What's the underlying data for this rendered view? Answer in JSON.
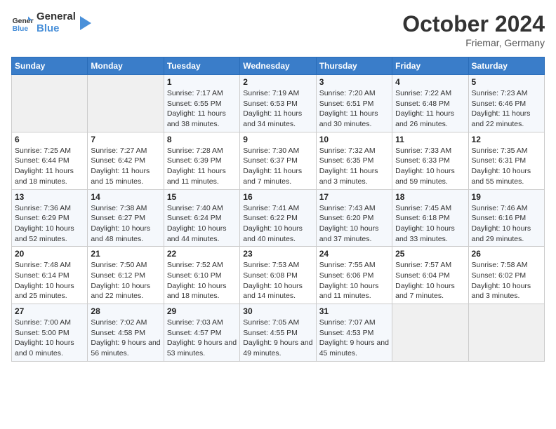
{
  "header": {
    "logo_general": "General",
    "logo_blue": "Blue",
    "month_title": "October 2024",
    "location": "Friemar, Germany"
  },
  "days_of_week": [
    "Sunday",
    "Monday",
    "Tuesday",
    "Wednesday",
    "Thursday",
    "Friday",
    "Saturday"
  ],
  "weeks": [
    [
      {
        "day": "",
        "empty": true
      },
      {
        "day": "",
        "empty": true
      },
      {
        "day": "1",
        "sunrise": "7:17 AM",
        "sunset": "6:55 PM",
        "daylight": "11 hours and 38 minutes."
      },
      {
        "day": "2",
        "sunrise": "7:19 AM",
        "sunset": "6:53 PM",
        "daylight": "11 hours and 34 minutes."
      },
      {
        "day": "3",
        "sunrise": "7:20 AM",
        "sunset": "6:51 PM",
        "daylight": "11 hours and 30 minutes."
      },
      {
        "day": "4",
        "sunrise": "7:22 AM",
        "sunset": "6:48 PM",
        "daylight": "11 hours and 26 minutes."
      },
      {
        "day": "5",
        "sunrise": "7:23 AM",
        "sunset": "6:46 PM",
        "daylight": "11 hours and 22 minutes."
      }
    ],
    [
      {
        "day": "6",
        "sunrise": "7:25 AM",
        "sunset": "6:44 PM",
        "daylight": "11 hours and 18 minutes."
      },
      {
        "day": "7",
        "sunrise": "7:27 AM",
        "sunset": "6:42 PM",
        "daylight": "11 hours and 15 minutes."
      },
      {
        "day": "8",
        "sunrise": "7:28 AM",
        "sunset": "6:39 PM",
        "daylight": "11 hours and 11 minutes."
      },
      {
        "day": "9",
        "sunrise": "7:30 AM",
        "sunset": "6:37 PM",
        "daylight": "11 hours and 7 minutes."
      },
      {
        "day": "10",
        "sunrise": "7:32 AM",
        "sunset": "6:35 PM",
        "daylight": "11 hours and 3 minutes."
      },
      {
        "day": "11",
        "sunrise": "7:33 AM",
        "sunset": "6:33 PM",
        "daylight": "10 hours and 59 minutes."
      },
      {
        "day": "12",
        "sunrise": "7:35 AM",
        "sunset": "6:31 PM",
        "daylight": "10 hours and 55 minutes."
      }
    ],
    [
      {
        "day": "13",
        "sunrise": "7:36 AM",
        "sunset": "6:29 PM",
        "daylight": "10 hours and 52 minutes."
      },
      {
        "day": "14",
        "sunrise": "7:38 AM",
        "sunset": "6:27 PM",
        "daylight": "10 hours and 48 minutes."
      },
      {
        "day": "15",
        "sunrise": "7:40 AM",
        "sunset": "6:24 PM",
        "daylight": "10 hours and 44 minutes."
      },
      {
        "day": "16",
        "sunrise": "7:41 AM",
        "sunset": "6:22 PM",
        "daylight": "10 hours and 40 minutes."
      },
      {
        "day": "17",
        "sunrise": "7:43 AM",
        "sunset": "6:20 PM",
        "daylight": "10 hours and 37 minutes."
      },
      {
        "day": "18",
        "sunrise": "7:45 AM",
        "sunset": "6:18 PM",
        "daylight": "10 hours and 33 minutes."
      },
      {
        "day": "19",
        "sunrise": "7:46 AM",
        "sunset": "6:16 PM",
        "daylight": "10 hours and 29 minutes."
      }
    ],
    [
      {
        "day": "20",
        "sunrise": "7:48 AM",
        "sunset": "6:14 PM",
        "daylight": "10 hours and 25 minutes."
      },
      {
        "day": "21",
        "sunrise": "7:50 AM",
        "sunset": "6:12 PM",
        "daylight": "10 hours and 22 minutes."
      },
      {
        "day": "22",
        "sunrise": "7:52 AM",
        "sunset": "6:10 PM",
        "daylight": "10 hours and 18 minutes."
      },
      {
        "day": "23",
        "sunrise": "7:53 AM",
        "sunset": "6:08 PM",
        "daylight": "10 hours and 14 minutes."
      },
      {
        "day": "24",
        "sunrise": "7:55 AM",
        "sunset": "6:06 PM",
        "daylight": "10 hours and 11 minutes."
      },
      {
        "day": "25",
        "sunrise": "7:57 AM",
        "sunset": "6:04 PM",
        "daylight": "10 hours and 7 minutes."
      },
      {
        "day": "26",
        "sunrise": "7:58 AM",
        "sunset": "6:02 PM",
        "daylight": "10 hours and 3 minutes."
      }
    ],
    [
      {
        "day": "27",
        "sunrise": "7:00 AM",
        "sunset": "5:00 PM",
        "daylight": "10 hours and 0 minutes."
      },
      {
        "day": "28",
        "sunrise": "7:02 AM",
        "sunset": "4:58 PM",
        "daylight": "9 hours and 56 minutes."
      },
      {
        "day": "29",
        "sunrise": "7:03 AM",
        "sunset": "4:57 PM",
        "daylight": "9 hours and 53 minutes."
      },
      {
        "day": "30",
        "sunrise": "7:05 AM",
        "sunset": "4:55 PM",
        "daylight": "9 hours and 49 minutes."
      },
      {
        "day": "31",
        "sunrise": "7:07 AM",
        "sunset": "4:53 PM",
        "daylight": "9 hours and 45 minutes."
      },
      {
        "day": "",
        "empty": true
      },
      {
        "day": "",
        "empty": true
      }
    ]
  ]
}
